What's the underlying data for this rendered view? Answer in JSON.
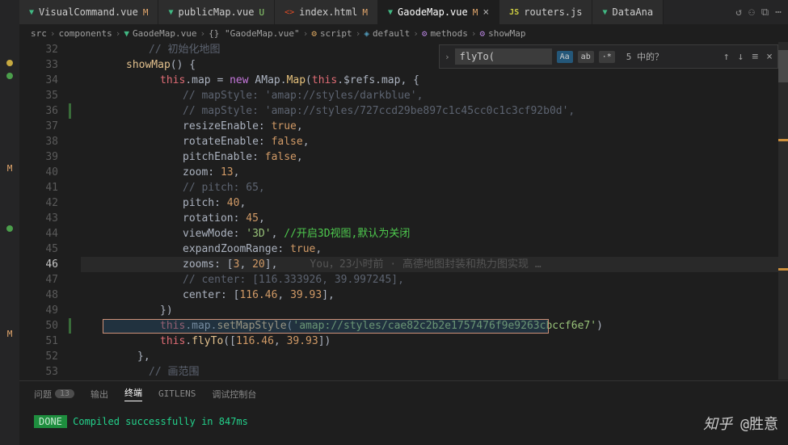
{
  "tabs": [
    {
      "name": "VisualCommand.vue",
      "icon": "vue",
      "status": "M"
    },
    {
      "name": "publicMap.vue",
      "icon": "vue",
      "status": "U"
    },
    {
      "name": "index.html",
      "icon": "html",
      "status": "M"
    },
    {
      "name": "GaodeMap.vue",
      "icon": "vue",
      "status": "M",
      "active": true,
      "closable": true
    },
    {
      "name": "routers.js",
      "icon": "js",
      "status": ""
    },
    {
      "name": "DataAna",
      "icon": "vue",
      "status": ""
    }
  ],
  "breadcrumbs": {
    "parts": [
      "src",
      "components",
      "GaodeMap.vue",
      "{} \"GaodeMap.vue\"",
      "script",
      "default",
      "methods",
      "showMap"
    ]
  },
  "find": {
    "value": "flyTo(",
    "matchCase": "Aa",
    "matchWord": "ab",
    "regex": "·*",
    "info": "5 中的？"
  },
  "gutter": [
    "32",
    "33",
    "34",
    "35",
    "36",
    "37",
    "38",
    "39",
    "40",
    "41",
    "42",
    "43",
    "44",
    "45",
    "46",
    "47",
    "48",
    "49",
    "50",
    "51",
    "52",
    "53"
  ],
  "current_line_index": 14,
  "code": {
    "l32": "// 初始化地图",
    "l33_a": "showMap",
    "l33_b": "() {",
    "l34_a": "this",
    "l34_b": ".map = ",
    "l34_c": "new",
    "l34_d": " AMap.",
    "l34_e": "Map",
    "l34_f": "(",
    "l34_g": "this",
    "l34_h": ".$refs.map, {",
    "l35": "// mapStyle: 'amap://styles/darkblue',",
    "l36": "// mapStyle: 'amap://styles/727ccd29be897c1c45cc0c1c3cf92b0d',",
    "l37_a": "resizeEnable: ",
    "l37_b": "true",
    "l37_c": ",",
    "l38_a": "rotateEnable: ",
    "l38_b": "false",
    "l38_c": ",",
    "l39_a": "pitchEnable: ",
    "l39_b": "false",
    "l39_c": ",",
    "l40_a": "zoom: ",
    "l40_b": "13",
    "l40_c": ",",
    "l41": "// pitch: 65,",
    "l42_a": "pitch: ",
    "l42_b": "40",
    "l42_c": ",",
    "l43_a": "rotation: ",
    "l43_b": "45",
    "l43_c": ",",
    "l44_a": "viewMode: ",
    "l44_b": "'3D'",
    "l44_c": ", ",
    "l44_d": "//开启3D视图,默认为关闭",
    "l45_a": "expandZoomRange: ",
    "l45_b": "true",
    "l45_c": ",",
    "l46_a": "zooms: [",
    "l46_b": "3",
    "l46_c": ", ",
    "l46_d": "20",
    "l46_e": "],",
    "l46_blame": "You，23小时前 · 高德地图封装和热力图实现 …",
    "l47": "// center: [116.333926, 39.997245],",
    "l48_a": "center: [",
    "l48_b": "116.46",
    "l48_c": ", ",
    "l48_d": "39.93",
    "l48_e": "],",
    "l49": "})",
    "l50_a": "this",
    "l50_b": ".map.",
    "l50_c": "setMapStyle",
    "l50_d": "(",
    "l50_e": "'amap://styles/cae82c2b2e1757476f9e9263cbccf6e7'",
    "l50_f": ")",
    "l51_a": "this",
    "l51_b": ".",
    "l51_c": "flyTo",
    "l51_d": "([",
    "l51_e": "116.46",
    "l51_f": ", ",
    "l51_g": "39.93",
    "l51_h": "])",
    "l52": "},",
    "l53": "// 画范围"
  },
  "panel": {
    "tabs": {
      "problems": "问题",
      "problems_count": "13",
      "output": "输出",
      "terminal": "终端",
      "gitlens": "GITLENS",
      "debug": "调试控制台"
    },
    "done": "DONE",
    "message": " Compiled successfully in 847ms"
  },
  "watermark": {
    "zhihu": "知乎",
    "author": "@胜意"
  }
}
